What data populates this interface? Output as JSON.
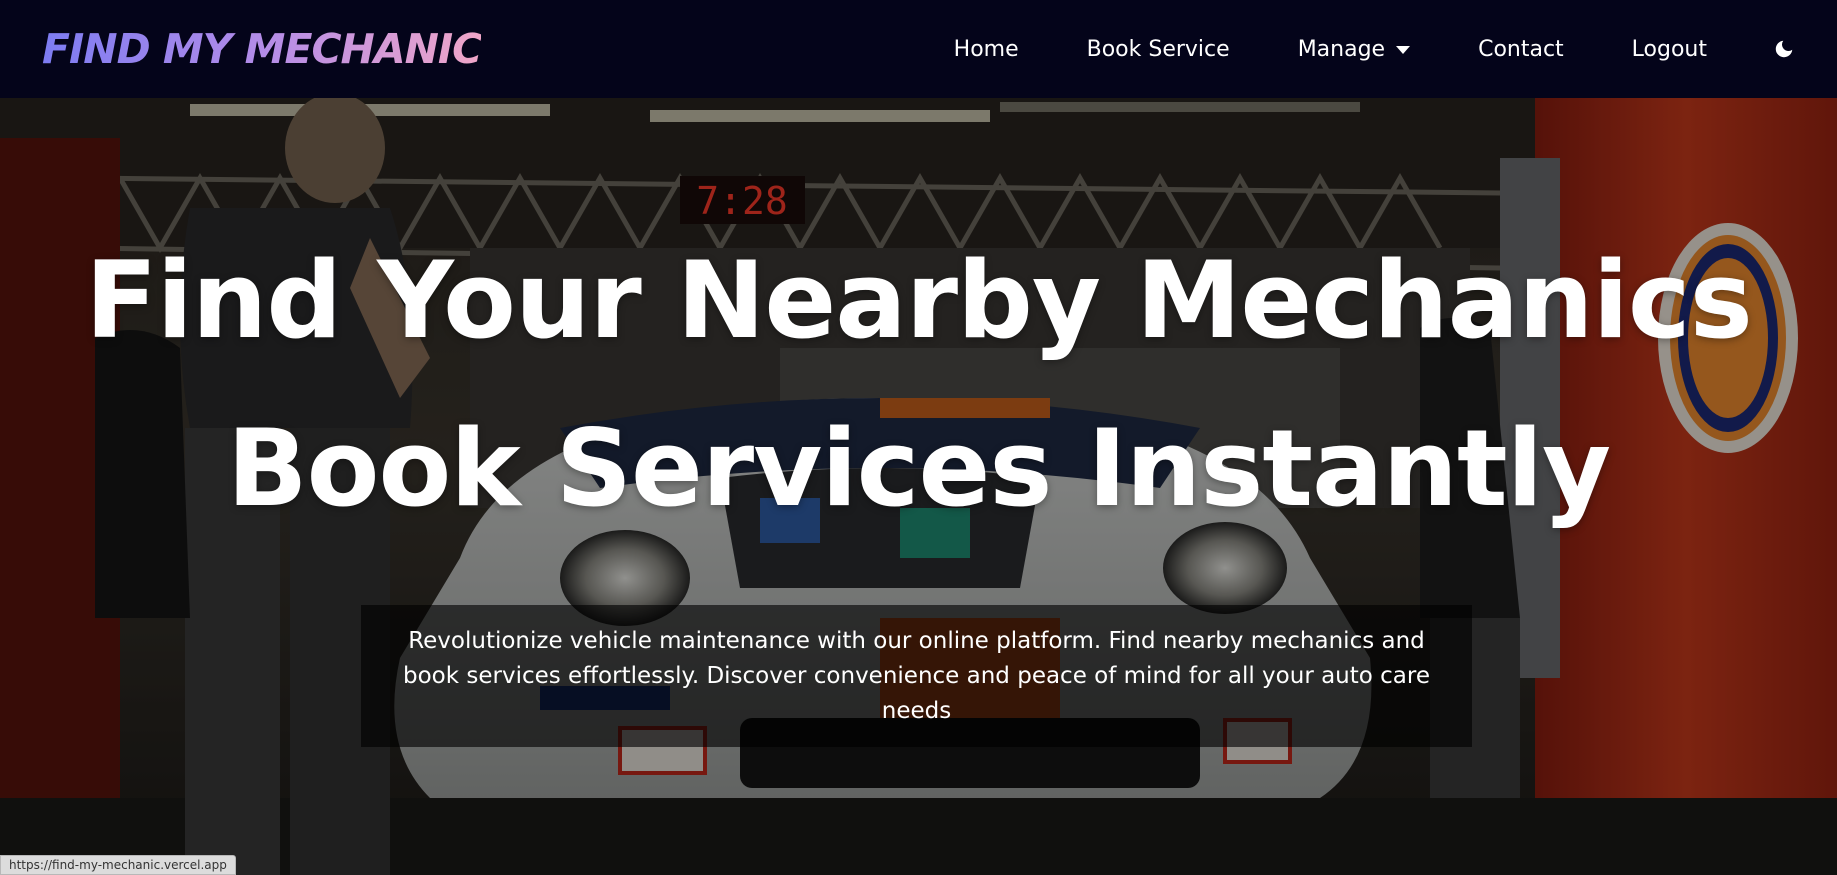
{
  "colors": {
    "navbar_bg": "#04041a",
    "brand_gradient_start": "#7d7cf2",
    "brand_gradient_mid": "#b38ce8",
    "brand_gradient_end": "#f0a6c8",
    "nav_text": "#ffffff",
    "hero_text": "#ffffff",
    "desc_box_bg": "rgba(0,0,0,0.62)"
  },
  "navbar": {
    "brand": "FIND MY MECHANIC",
    "links": [
      {
        "label": "Home"
      },
      {
        "label": "Book Service"
      },
      {
        "label": "Manage",
        "has_dropdown": true
      },
      {
        "label": "Contact"
      },
      {
        "label": "Logout"
      }
    ],
    "theme_toggle_icon": "moon-icon"
  },
  "hero": {
    "background": "garage-race-car-photo",
    "title_line1": "Find Your Nearby Mechanics",
    "title_line2": "Book Services Instantly",
    "description": "Revolutionize vehicle maintenance with our online platform. Find nearby mechanics and book services effortlessly. Discover convenience and peace of mind for all your auto care needs"
  },
  "status_bar": {
    "url": "https://find-my-mechanic.vercel.app"
  }
}
